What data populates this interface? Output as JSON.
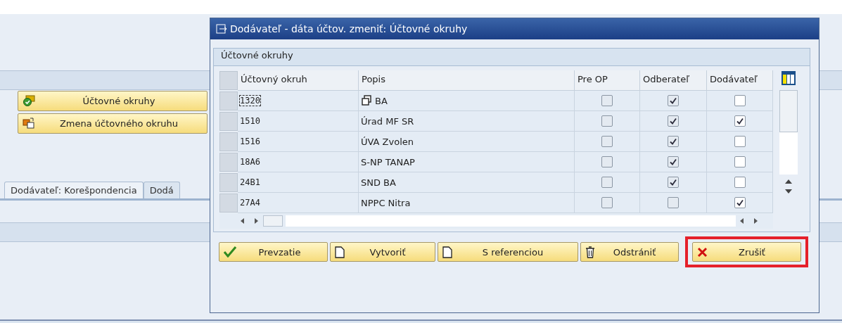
{
  "background": {
    "buttons": [
      {
        "label": "Účtovné okruhy",
        "kind": "check-folder"
      },
      {
        "label": "Zmena účtovného okruhu",
        "kind": "swap"
      }
    ],
    "tabs": [
      {
        "label": "Dodávateľ: Korešpondencia",
        "selected": true
      },
      {
        "label": "Dodá",
        "selected": false
      }
    ]
  },
  "dialog": {
    "title": "Dodávateľ - dáta účtov. zmeniť: Účtovné okruhy",
    "group_title": "Účtovné okruhy",
    "table": {
      "columns": [
        {
          "label": "Účtovný okruh",
          "kind": "text"
        },
        {
          "label": "Popis",
          "kind": "text"
        },
        {
          "label": "Pre OP",
          "kind": "checkbox",
          "editable": false
        },
        {
          "label": "Odberateľ",
          "kind": "checkbox",
          "editable": false
        },
        {
          "label": "Dodávateľ",
          "kind": "checkbox",
          "editable": true
        }
      ],
      "rows": [
        {
          "focused": true,
          "cells": [
            "1320",
            "BA",
            false,
            true,
            false
          ]
        },
        {
          "focused": false,
          "cells": [
            "1510",
            "Úrad MF SR",
            false,
            true,
            true
          ]
        },
        {
          "focused": false,
          "cells": [
            "1516",
            "ÚVA Zvolen",
            false,
            true,
            false
          ]
        },
        {
          "focused": false,
          "cells": [
            "18A6",
            "S-NP TANAP",
            false,
            true,
            false
          ]
        },
        {
          "focused": false,
          "cells": [
            "24B1",
            "SND BA",
            false,
            true,
            false
          ]
        },
        {
          "focused": false,
          "cells": [
            "27A4",
            "NPPC Nitra",
            false,
            false,
            true
          ]
        }
      ]
    },
    "buttons": [
      {
        "label": "Prevzatie",
        "kind": "check",
        "highlighted": false
      },
      {
        "label": "Vytvoriť",
        "kind": "page",
        "highlighted": false
      },
      {
        "label": "S referenciou",
        "kind": "page",
        "highlighted": false
      },
      {
        "label": "Odstrániť",
        "kind": "trash",
        "highlighted": false
      },
      {
        "label": "Zrušiť",
        "kind": "cross",
        "highlighted": true
      }
    ]
  }
}
